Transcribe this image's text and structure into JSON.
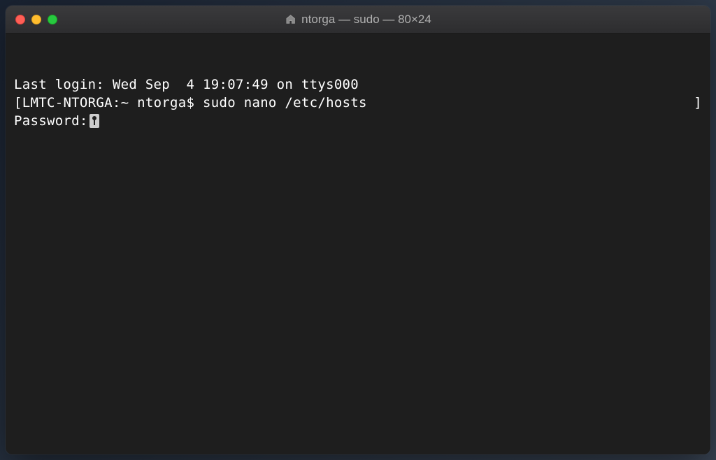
{
  "window": {
    "title": "ntorga — sudo — 80×24"
  },
  "terminal": {
    "last_login": "Last login: Wed Sep  4 19:07:49 on ttys000",
    "prompt_open": "[",
    "prompt_host": "LMTC-NTORGA:~ ntorga$ ",
    "command": "sudo nano /etc/hosts",
    "prompt_close": "]",
    "password_prompt": "Password:"
  }
}
